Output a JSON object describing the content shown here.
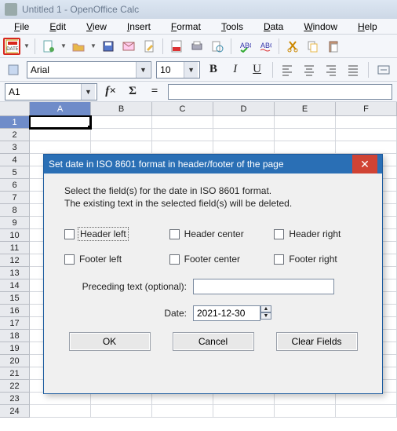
{
  "titlebar": {
    "text": "Untitled 1 - OpenOffice Calc"
  },
  "menu": {
    "file": "File",
    "edit": "Edit",
    "view": "View",
    "insert": "Insert",
    "format": "Format",
    "tools": "Tools",
    "data": "Data",
    "window": "Window",
    "help": "Help"
  },
  "format": {
    "font_name": "Arial",
    "font_size": "10",
    "bold": "B",
    "italic": "I",
    "underline": "U"
  },
  "cellref": {
    "active": "A1"
  },
  "columns": [
    "A",
    "B",
    "C",
    "D",
    "E",
    "F"
  ],
  "rowcount": 24,
  "dialog": {
    "title": "Set date in ISO 8601 format in header/footer of the page",
    "desc1": "Select the field(s) for the date in ISO 8601 format.",
    "desc2": "The existing text in the selected field(s) will be deleted.",
    "chk": {
      "hl": "Header left",
      "hc": "Header center",
      "hr": "Header right",
      "fl": "Footer left",
      "fc": "Footer center",
      "fr": "Footer right"
    },
    "preceding_label": "Preceding text (optional):",
    "preceding_value": "",
    "date_label": "Date:",
    "date_value": "2021-12-30",
    "ok": "OK",
    "cancel": "Cancel",
    "clear": "Clear Fields"
  },
  "colors": {
    "accent": "#2a6fb5",
    "danger": "#d04334"
  }
}
